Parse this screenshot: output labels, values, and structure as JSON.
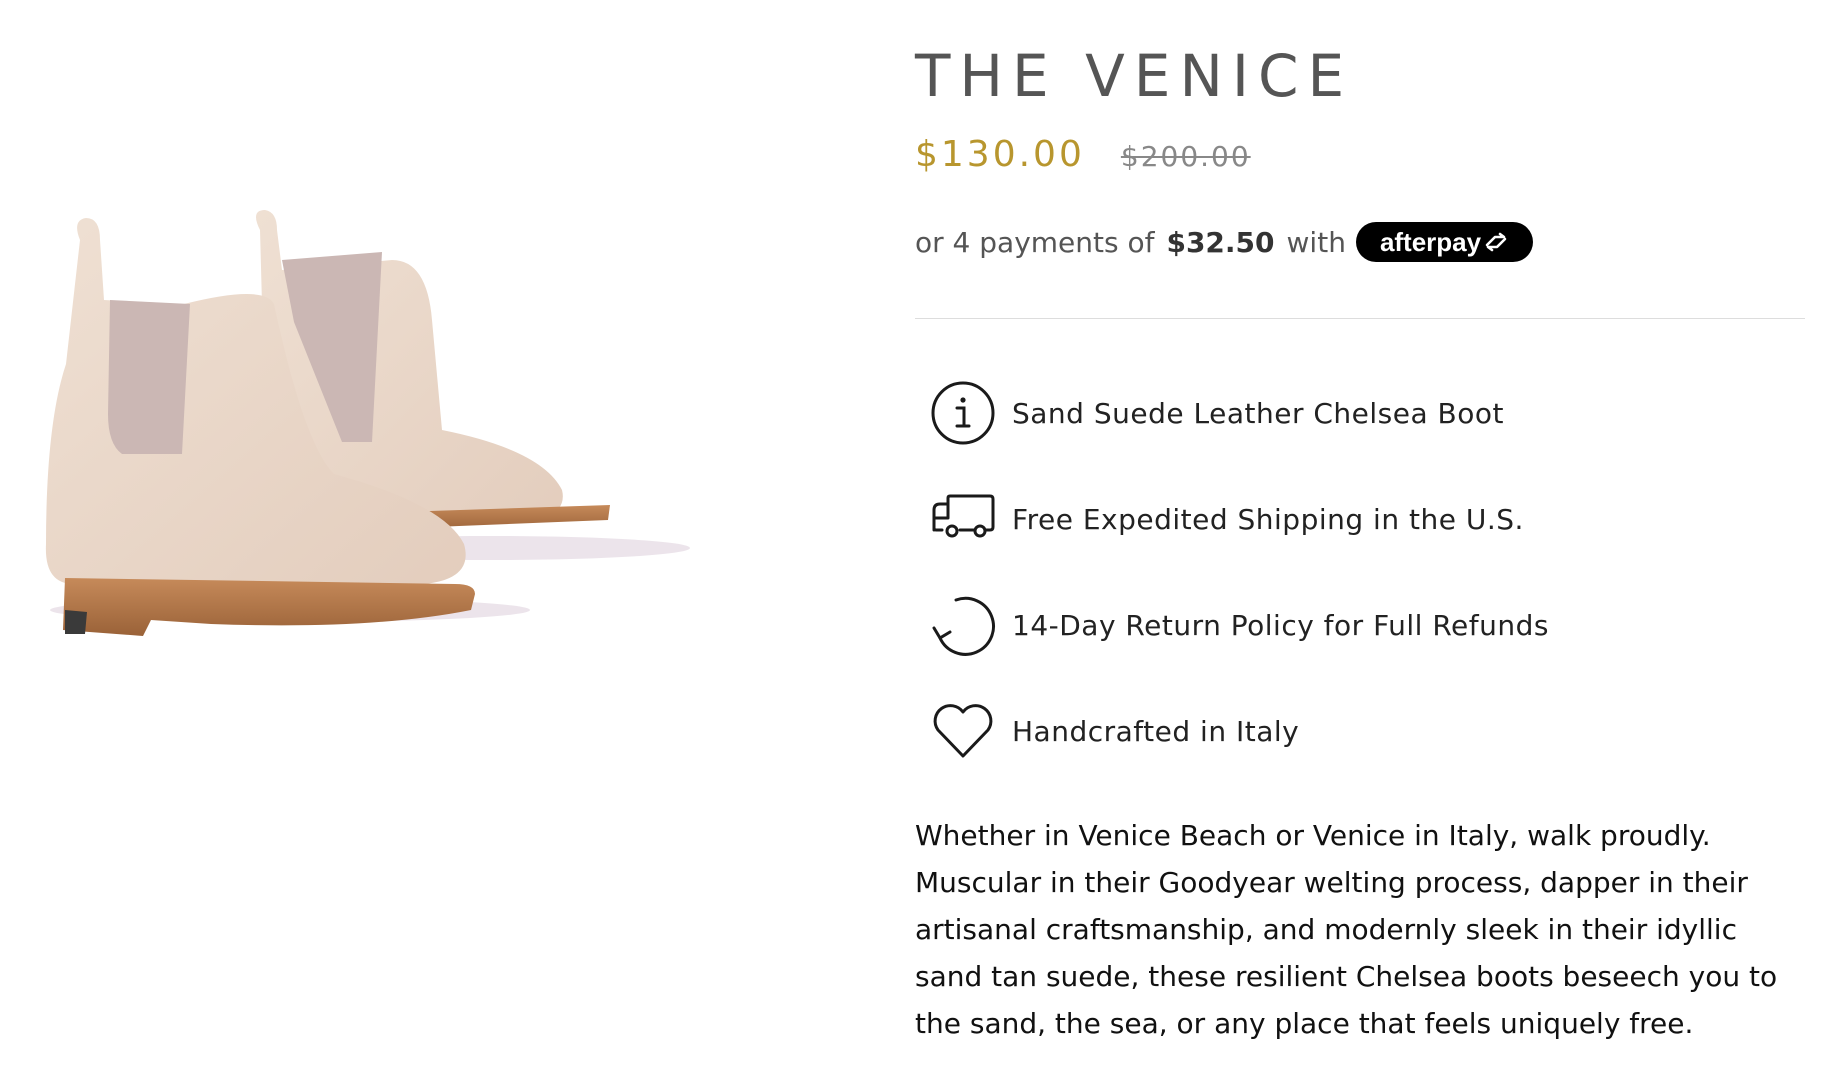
{
  "product": {
    "title": "THE VENICE",
    "price_sale": "$130.00",
    "price_compare": "$200.00",
    "accent_color": "#b8962e",
    "image_alt": "Pair of sand suede Chelsea boots"
  },
  "installments": {
    "prefix": "or 4 payments of",
    "amount": "$32.50",
    "suffix": "with",
    "provider_label": "afterpay"
  },
  "features": [
    {
      "icon": "info-icon",
      "label": "Sand Suede Leather Chelsea Boot"
    },
    {
      "icon": "truck-icon",
      "label": "Free Expedited Shipping in the U.S."
    },
    {
      "icon": "return-icon",
      "label": "14-Day Return Policy for Full Refunds"
    },
    {
      "icon": "heart-icon",
      "label": "Handcrafted in Italy"
    }
  ],
  "description": "Whether in Venice Beach or Venice in Italy, walk proudly. Muscular in their Goodyear welting process, dapper in their artisanal craftsmanship, and modernly sleek in their idyllic sand tan suede, these resilient Chelsea boots beseech you to the sand, the sea, or any place that feels uniquely free."
}
